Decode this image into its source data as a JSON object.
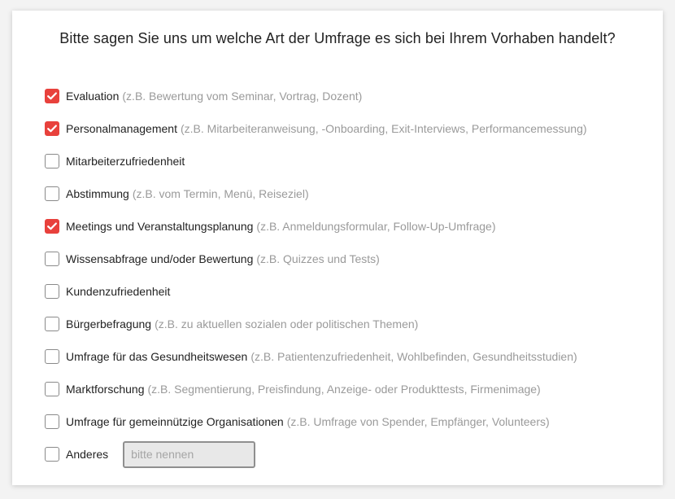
{
  "survey": {
    "question": "Bitte sagen Sie uns um welche Art der Umfrage es sich bei Ihrem Vorhaben handelt?",
    "accent_color": "#e8413c",
    "options": [
      {
        "label": "Evaluation",
        "hint": "(z.B. Bewertung vom Seminar, Vortrag, Dozent)",
        "checked": true
      },
      {
        "label": "Personalmanagement",
        "hint": "(z.B. Mitarbeiteranweisung, -Onboarding, Exit-Interviews, Performancemessung)",
        "checked": true
      },
      {
        "label": "Mitarbeiterzufriedenheit",
        "hint": "",
        "checked": false
      },
      {
        "label": "Abstimmung",
        "hint": "(z.B. vom Termin, Menü, Reiseziel)",
        "checked": false
      },
      {
        "label": "Meetings und Veranstaltungsplanung",
        "hint": "(z.B. Anmeldungsformular, Follow-Up-Umfrage)",
        "checked": true
      },
      {
        "label": "Wissensabfrage und/oder Bewertung",
        "hint": "(z.B. Quizzes und Tests)",
        "checked": false
      },
      {
        "label": "Kundenzufriedenheit",
        "hint": "",
        "checked": false
      },
      {
        "label": "Bürgerbefragung",
        "hint": "(z.B. zu aktuellen sozialen oder politischen Themen)",
        "checked": false
      },
      {
        "label": "Umfrage für das Gesundheitswesen",
        "hint": "(z.B. Patientenzufriedenheit, Wohlbefinden, Gesundheitsstudien)",
        "checked": false
      },
      {
        "label": "Marktforschung",
        "hint": "(z.B. Segmentierung, Preisfindung, Anzeige- oder Produkttests, Firmenimage)",
        "checked": false
      },
      {
        "label": "Umfrage für gemeinnützige Organisationen",
        "hint": "(z.B. Umfrage von Spender, Empfänger, Volunteers)",
        "checked": false
      }
    ],
    "other": {
      "label": "Anderes",
      "checked": false,
      "value": "",
      "placeholder": "bitte nennen"
    }
  }
}
